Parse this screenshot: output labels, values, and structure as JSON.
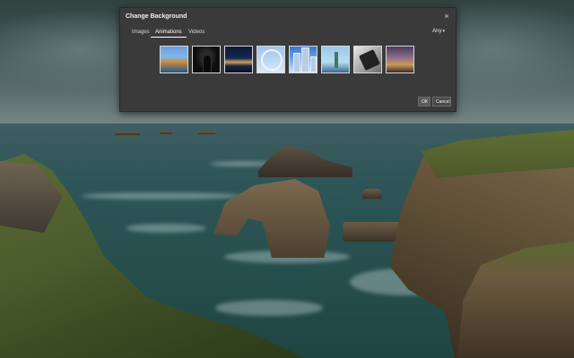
{
  "dialog": {
    "title": "Change Background",
    "close_glyph": "×",
    "tabs": [
      {
        "label": "Images",
        "active": false
      },
      {
        "label": "Animations",
        "active": true
      },
      {
        "label": "Videos",
        "active": false
      }
    ],
    "filter": {
      "label": "Any",
      "caret": "▾"
    },
    "thumbnails": [
      {
        "subject": "harbor-sunset"
      },
      {
        "subject": "woman-silhouette"
      },
      {
        "subject": "city-night"
      },
      {
        "subject": "ferris-wheel"
      },
      {
        "subject": "skyscrapers"
      },
      {
        "subject": "statue-of-liberty"
      },
      {
        "subject": "smartphone"
      },
      {
        "subject": "city-dusk"
      }
    ],
    "ok_label": "OK",
    "cancel_label": "Cancel"
  },
  "colors": {
    "dialog_bg": "#3a3a3a",
    "accent_active_tab": "#ffffff"
  },
  "icons": {
    "close": "close-icon",
    "dropdown": "chevron-down-icon"
  }
}
